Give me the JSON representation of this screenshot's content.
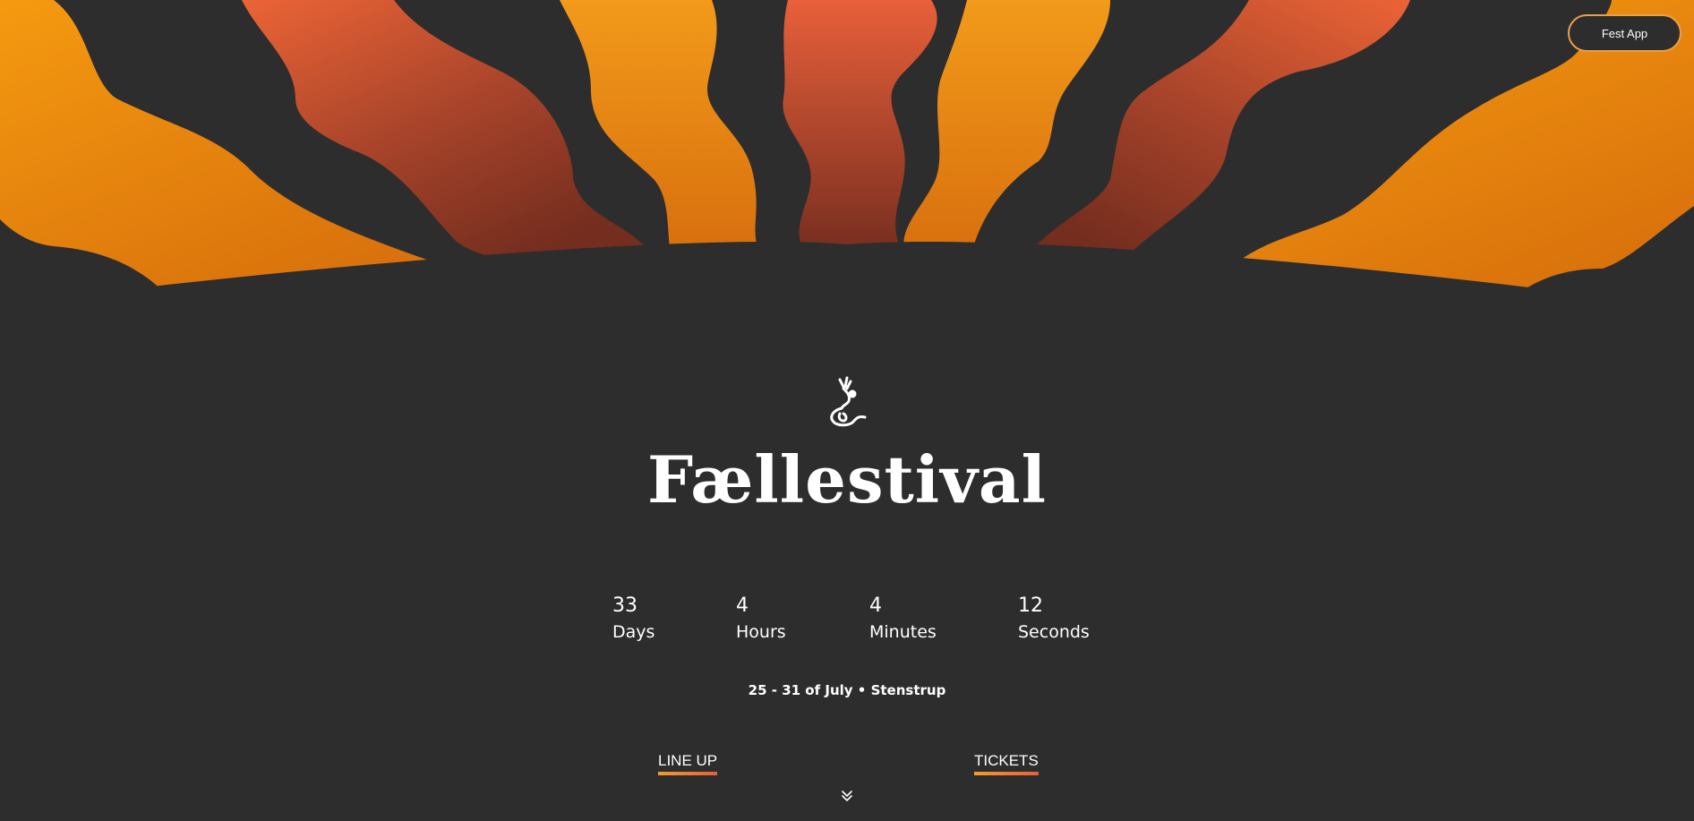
{
  "header": {
    "fest_app_label": "Fest App"
  },
  "hero": {
    "logo_icon": "dancing-figure-icon",
    "title": "Fællestival",
    "countdown": [
      {
        "value": "33",
        "label": "Days"
      },
      {
        "value": "4",
        "label": "Hours"
      },
      {
        "value": "4",
        "label": "Minutes"
      },
      {
        "value": "12",
        "label": "Seconds"
      }
    ],
    "event_info": "25 - 31 of July • Stenstrup"
  },
  "nav": {
    "lineup_label": "LINE UP",
    "tickets_label": "TICKETS",
    "scroll_icon": "chevron-double-down-icon"
  },
  "colors": {
    "background": "#2e2d2e",
    "ray_orange": "#f29a1a",
    "ray_red": "#e8603a",
    "ray_dark": "#7a2f20",
    "accent_border": "#e8a04a"
  }
}
